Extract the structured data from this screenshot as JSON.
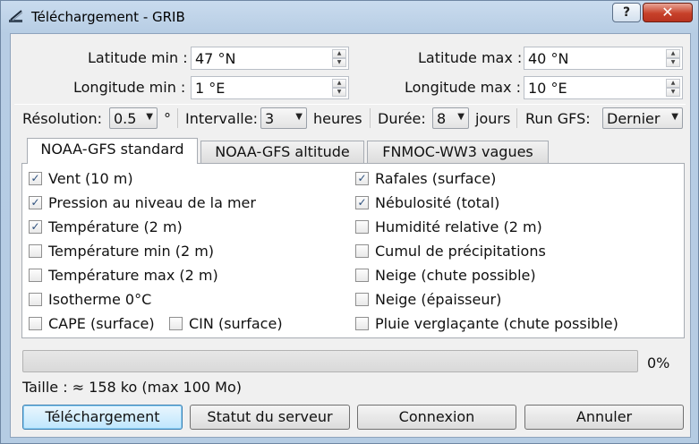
{
  "window": {
    "title": "Téléchargement - GRIB",
    "help_label": "?",
    "close_label": "✕"
  },
  "coords": {
    "lat_min_label": "Latitude min :",
    "lat_min_value": "47 °N",
    "lat_max_label": "Latitude max :",
    "lat_max_value": "40 °N",
    "lon_min_label": "Longitude min :",
    "lon_min_value": "1 °E",
    "lon_max_label": "Longitude max :",
    "lon_max_value": "10 °E"
  },
  "params": {
    "resolution_label": "Résolution:",
    "resolution_value": "0.5",
    "resolution_unit": "°",
    "interval_label": "Intervalle:",
    "interval_value": "3",
    "interval_unit": "heures",
    "duration_label": "Durée:",
    "duration_value": "8",
    "duration_unit": "jours",
    "run_label": "Run GFS:",
    "run_value": "Dernier"
  },
  "tabs": [
    {
      "label": "NOAA-GFS standard"
    },
    {
      "label": "NOAA-GFS altitude"
    },
    {
      "label": "FNMOC-WW3 vagues"
    }
  ],
  "checkboxes": {
    "left": [
      {
        "label": "Vent (10 m)",
        "checked": true
      },
      {
        "label": "Pression au niveau de la mer",
        "checked": true
      },
      {
        "label": "Température (2 m)",
        "checked": true
      },
      {
        "label": "Température min (2 m)",
        "checked": false
      },
      {
        "label": "Température max (2 m)",
        "checked": false
      },
      {
        "label": "Isotherme 0°C",
        "checked": false
      },
      {
        "label": "CAPE (surface)",
        "checked": false
      }
    ],
    "cin": {
      "label": "CIN (surface)",
      "checked": false
    },
    "right": [
      {
        "label": "Rafales (surface)",
        "checked": true
      },
      {
        "label": "Nébulosité (total)",
        "checked": true
      },
      {
        "label": "Humidité relative (2 m)",
        "checked": false
      },
      {
        "label": "Cumul de précipitations",
        "checked": false
      },
      {
        "label": "Neige (chute possible)",
        "checked": false
      },
      {
        "label": "Neige (épaisseur)",
        "checked": false
      },
      {
        "label": "Pluie verglaçante (chute possible)",
        "checked": false
      }
    ]
  },
  "progress": {
    "percent_label": "0%",
    "value": 0
  },
  "size_text": "Taille : ≈ 158 ko (max 100 Mo)",
  "buttons": {
    "download": "Téléchargement",
    "server_status": "Statut du serveur",
    "connect": "Connexion",
    "cancel": "Annuler"
  },
  "glyphs": {
    "check": "✓",
    "up": "▲",
    "down": "▼"
  },
  "colors": {
    "progress_fill": "#3cb043",
    "check": "#2c4f7c"
  }
}
